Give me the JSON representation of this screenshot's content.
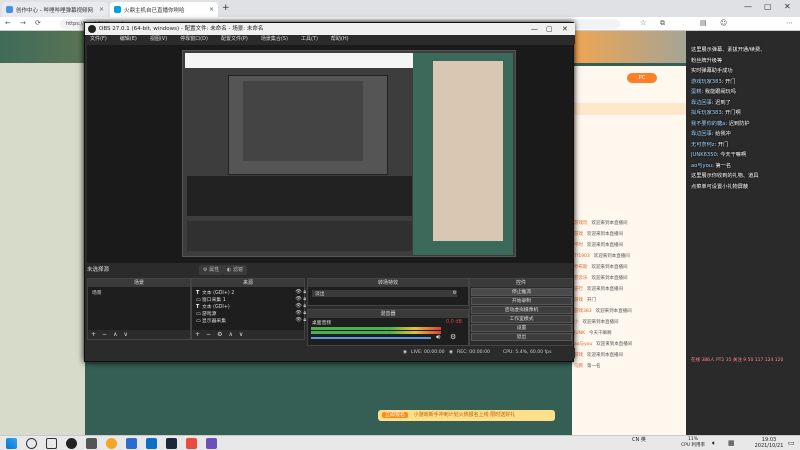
{
  "browser": {
    "tabs": [
      {
        "label": "创作中心 - 哔哩哔哩弹幕视频网",
        "active": false
      },
      {
        "label": "火鼎主机自已直播你咧哈",
        "active": true
      }
    ],
    "new_tab": "+",
    "url": "https://live.bilibili.com/"
  },
  "obs": {
    "title": "OBS 27.0.1 (64-bit, windows) - 配置文件: 未命名 - 场景: 未命名",
    "menu": [
      "文件(F)",
      "编辑(E)",
      "视图(V)",
      "停靠窗口(D)",
      "配置文件(P)",
      "场景集合(S)",
      "工具(T)",
      "帮助(H)"
    ],
    "scene_select_label": "未选择源",
    "ctx_tabs": [
      "属性",
      "滤镜"
    ],
    "scenes": {
      "header": "场景",
      "items": [
        "场景"
      ]
    },
    "sources": {
      "header": "来源",
      "items": [
        {
          "label": "文本 (GDI+) 2",
          "icon": "T"
        },
        {
          "label": "窗口采集 1",
          "icon": "▭"
        },
        {
          "label": "文本 (GDI+)",
          "icon": "T"
        },
        {
          "label": "游戏源",
          "icon": "▭"
        },
        {
          "label": "显示器采集",
          "icon": "▭"
        }
      ]
    },
    "transitions": {
      "header": "转场特效",
      "value": "淡出"
    },
    "mixer": {
      "header": "混音器",
      "channel": "桌面音频",
      "db": "0.0 dB"
    },
    "controls": {
      "header": "控件",
      "buttons": [
        "停止推流",
        "开始录制",
        "启动虚拟摄像机",
        "工作室模式",
        "设置",
        "退出"
      ]
    },
    "status": {
      "live": "LIVE: 00:00:00",
      "rec": "REC: 00:00:00",
      "cpu": "CPU: 5.4%, 60.00 fps"
    }
  },
  "chat_overlay": [
    {
      "user": "",
      "text": "这里展示弹幕、素拔开通/续费、"
    },
    {
      "user": "",
      "text": "粉丝牌升级等"
    },
    {
      "user": "",
      "text": "实时弹幕助手成功"
    },
    {
      "user": "游戏玩家383",
      "text": "开门"
    },
    {
      "user": "蛋糕",
      "text": "我能跟闹玩吗"
    },
    {
      "user": "靠边回事",
      "text": "迟到了"
    },
    {
      "user": "拟斥玩家383",
      "text": "开门啊"
    },
    {
      "user": "我不要你的糖a",
      "text": "迟到防护"
    },
    {
      "user": "靠边回事",
      "text": "给我冲"
    },
    {
      "user": "无可奈何z",
      "text": "开门"
    },
    {
      "user": "JUNK6350",
      "text": "今天干嘛啊"
    },
    {
      "user": "ao与you",
      "text": "第一名"
    },
    {
      "user": "",
      "text": "这里展示你收到的礼物、道具"
    },
    {
      "user": "",
      "text": ""
    },
    {
      "user": "",
      "text": "点菜单可设置小礼物屏蔽"
    }
  ],
  "overlay_status": "在线 386人 PT2 35 关注 9 50 117 124 120",
  "page_chat": [
    {
      "name": "游戏玩",
      "text": "欢迎来到本直播间"
    },
    {
      "name": "游戏",
      "text": "欢迎来到本直播间"
    },
    {
      "name": "平时",
      "text": "欢迎来到本直播间"
    },
    {
      "name": "Tf1903",
      "text": "欢迎来到本直播间"
    },
    {
      "name": "乔布斯",
      "text": "欢迎来到本直播间"
    },
    {
      "name": "苍云乐",
      "text": "欢迎来到本直播间"
    },
    {
      "name": "逆行",
      "text": "欢迎来到本直播间"
    },
    {
      "name": "游戏",
      "text": "开门"
    },
    {
      "name": "游戏383",
      "text": "欢迎来到本直播间"
    },
    {
      "name": "小",
      "text": "欢迎来到本直播间"
    },
    {
      "name": "JUNK",
      "text": "今天干嘛啊"
    },
    {
      "name": "ao与you",
      "text": "欢迎来到本直播间"
    },
    {
      "name": "游戏",
      "text": "欢迎来到本直播间"
    },
    {
      "name": "乌鸦",
      "text": "第一名"
    }
  ],
  "page_button": "PC",
  "bottom_banner": {
    "highlight": "立即报名",
    "text": "小游戏新手冲刺计划火热报名上线 限时送好礼"
  },
  "taskbar": {
    "tray": "CN 英",
    "cpu": "11%",
    "cpu_label": "CPU 利用率",
    "time": "19:03",
    "date": "2021/10/21"
  }
}
